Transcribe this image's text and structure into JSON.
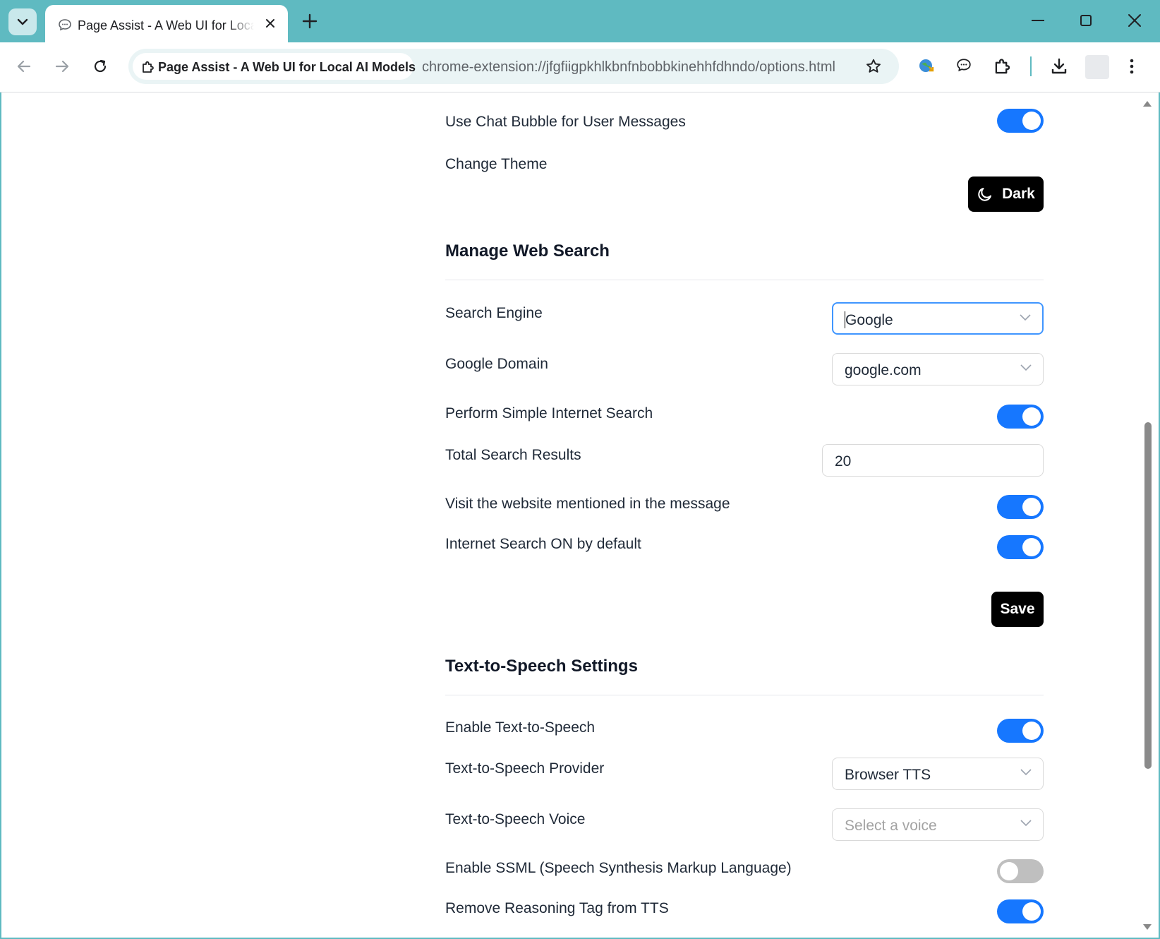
{
  "browser": {
    "tab_title": "Page Assist - A Web UI for Local AI Models",
    "site_chip": "Page Assist - A Web UI for Local AI Models",
    "url": "chrome-extension://jfgfiigpkhlkbnfnbobbkinehhfdhndo/options.html"
  },
  "appearance": {
    "chat_bubble_label": "Use Chat Bubble for User Messages",
    "chat_bubble_on": true,
    "theme_label": "Change Theme",
    "theme_button": "Dark"
  },
  "web_search": {
    "heading": "Manage Web Search",
    "engine_label": "Search Engine",
    "engine_value": "Google",
    "domain_label": "Google Domain",
    "domain_value": "google.com",
    "simple_search_label": "Perform Simple Internet Search",
    "simple_search_on": true,
    "total_results_label": "Total Search Results",
    "total_results_value": "20",
    "visit_website_label": "Visit the website mentioned in the message",
    "visit_website_on": true,
    "search_default_label": "Internet Search ON by default",
    "search_default_on": true,
    "save_button": "Save"
  },
  "tts": {
    "heading": "Text-to-Speech Settings",
    "enable_label": "Enable Text-to-Speech",
    "enable_on": true,
    "provider_label": "Text-to-Speech Provider",
    "provider_value": "Browser TTS",
    "voice_label": "Text-to-Speech Voice",
    "voice_placeholder": "Select a voice",
    "ssml_label": "Enable SSML (Speech Synthesis Markup Language)",
    "ssml_on": false,
    "reasoning_label": "Remove Reasoning Tag from TTS",
    "reasoning_on": true
  },
  "colors": {
    "accent": "#1677ff",
    "chrome_frame": "#5fbac1"
  }
}
